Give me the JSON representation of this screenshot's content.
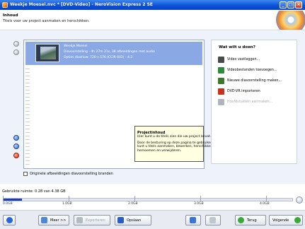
{
  "window": {
    "title": "Weekje Moesel.nvc * [DVD-Video] - NeroVision Express 2 SE"
  },
  "header": {
    "title": "Inhoud",
    "subtitle": "Titels voor uw project aanmaken en herschikken."
  },
  "list": {
    "item": {
      "title": "Weekje Moesel",
      "line1": "Diavoorstelling - 4h 27m 21s, 38 afbeeldingen met audio",
      "line2": "Opties diashow: 720 x 576 (CCIR 601) - 4:3"
    },
    "checkbox_label": "Originele afbeeldingen diavoorstelling branden",
    "checkbox_checked": false
  },
  "tooltip": {
    "title": "Projectinhoud",
    "line1": "Hier kunt u de titels zien die uw project bevat.",
    "line2": "Door de besturing op deze pagina te gebruiken",
    "line3": "kunt u titels aanmaken, bewerken, herschikken,",
    "line4": "hernoemen en verwijderen."
  },
  "actions": {
    "title": "Wat wilt u doen?",
    "items": [
      {
        "label": "Video vastleggen...",
        "icon": "camera-icon",
        "enabled": true,
        "color": "#4a4a4a"
      },
      {
        "label": "Videobestanden toevoegen...",
        "icon": "add-video-icon",
        "enabled": true,
        "color": "#2e8b3a"
      },
      {
        "label": "Nieuwe diavoorstelling maken...",
        "icon": "slideshow-icon",
        "enabled": true,
        "color": "#3a7a2a"
      },
      {
        "label": "DVD-VR importeren",
        "icon": "dvd-import-icon",
        "enabled": true,
        "color": "#c8301c"
      },
      {
        "label": "Hoofdstukken aanmaken...",
        "icon": "chapters-icon",
        "enabled": false,
        "color": "#b0b4bc"
      }
    ]
  },
  "status": {
    "text": "Gebruikte ruimte: 0.28 van 4.38 GB",
    "used_fraction": 0.064
  },
  "size_bar": {
    "ticks": [
      "0.0GB",
      "1.0GB",
      "2.0GB",
      "3.0GB",
      "4.0GB"
    ],
    "max_gb": 4.38,
    "fill_color": "#1c3eb6"
  },
  "footer": {
    "more_label": "Meer >>",
    "export_label": "Exporteren",
    "save_label": "Opslaan",
    "back_label": "Terug",
    "next_label": "Volgende"
  },
  "colors": {
    "titlebar": "#0a4fd6",
    "selection": "#8aa8e4",
    "tooltip_bg": "#ffffe1"
  }
}
